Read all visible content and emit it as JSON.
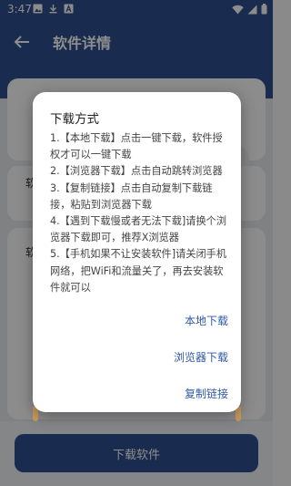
{
  "status_bar": {
    "time": "3:47",
    "left_icons": [
      "image-icon",
      "download-icon",
      "a-box-icon"
    ],
    "right_icons": [
      "wifi-icon",
      "signal-icon",
      "battery-icon"
    ]
  },
  "app_bar": {
    "title": "软件详情",
    "back_icon": "arrow-left-icon"
  },
  "background_fragments": {
    "side_char_1": "软",
    "side_char_2": "软"
  },
  "bottom": {
    "download_label": "下载软件"
  },
  "dialog": {
    "title": "下载方式",
    "lines": [
      "1.【本地下载】点击一键下载，软件授权才可以一键下载",
      "2.【浏览器下载】点击自动跳转浏览器",
      "3.【复制链接】点击自动复制下载链接，粘贴到浏览器下载",
      "4.【遇到下载慢或者无法下载]请换个浏览器下载即可，推荐X浏览器",
      "5.【手机如果不让安装软件]请关闭手机网络，把WiFi和流量关了，再去安装软件就可以"
    ],
    "actions": {
      "local": "本地下载",
      "browser": "浏览器下载",
      "copy": "复制链接"
    }
  },
  "colors": {
    "primary": "#2f4f8e",
    "action_text": "#2f5aa8",
    "overlay": "rgba(0,0,0,0.45)"
  }
}
